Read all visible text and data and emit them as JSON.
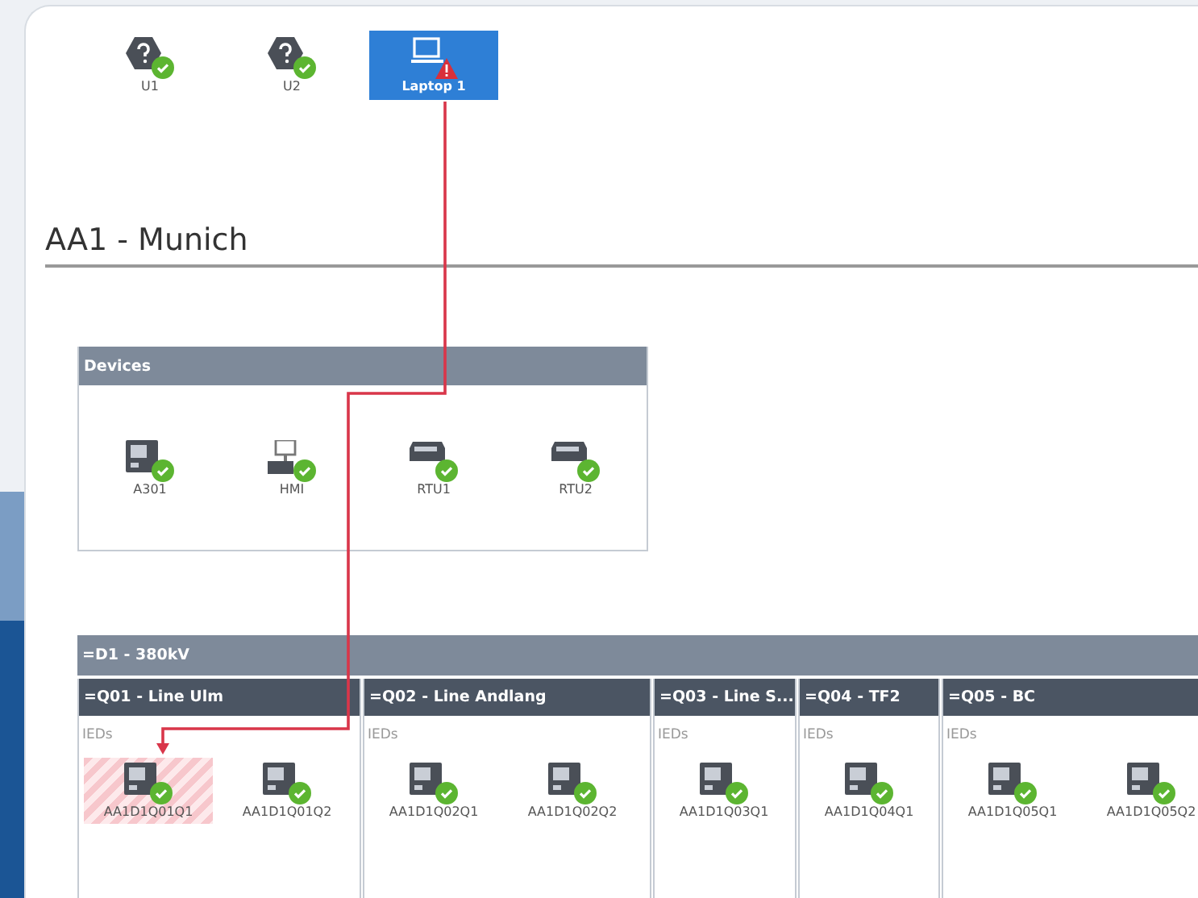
{
  "users": [
    {
      "label": "U1",
      "kind": "unknown",
      "alert": false,
      "selected": false
    },
    {
      "label": "U2",
      "kind": "unknown",
      "alert": false,
      "selected": false
    },
    {
      "label": "Laptop 1",
      "kind": "laptop",
      "alert": true,
      "selected": true
    }
  ],
  "title": "AA1 - Munich",
  "devices": {
    "title": "Devices",
    "items": [
      {
        "label": "A301",
        "kind": "ied",
        "alert": false
      },
      {
        "label": "HMI",
        "kind": "hmi",
        "alert": false
      },
      {
        "label": "RTU1",
        "kind": "rtu",
        "alert": false
      },
      {
        "label": "RTU2",
        "kind": "rtu",
        "alert": false
      }
    ]
  },
  "voltage_level": {
    "title": "=D1 - 380kV",
    "bays": [
      {
        "title": "=Q01 - Line Ulm",
        "group_label": "IEDs",
        "ieds": [
          {
            "label": "AA1D1Q01Q1",
            "kind": "ied",
            "alert": false,
            "selected": true
          },
          {
            "label": "AA1D1Q01Q2",
            "kind": "ied",
            "alert": false,
            "selected": false
          }
        ]
      },
      {
        "title": "=Q02 - Line Andlang",
        "group_label": "IEDs",
        "ieds": [
          {
            "label": "AA1D1Q02Q1",
            "kind": "ied",
            "alert": false,
            "selected": false
          },
          {
            "label": "AA1D1Q02Q2",
            "kind": "ied",
            "alert": false,
            "selected": false
          }
        ]
      },
      {
        "title": "=Q03 - Line S...",
        "group_label": "IEDs",
        "ieds": [
          {
            "label": "AA1D1Q03Q1",
            "kind": "ied",
            "alert": false,
            "selected": false
          }
        ]
      },
      {
        "title": "=Q04 - TF2",
        "group_label": "IEDs",
        "ieds": [
          {
            "label": "AA1D1Q04Q1",
            "kind": "ied",
            "alert": false,
            "selected": false
          }
        ]
      },
      {
        "title": "=Q05 - BC",
        "group_label": "IEDs",
        "ieds": [
          {
            "label": "AA1D1Q05Q1",
            "kind": "ied",
            "alert": false,
            "selected": false
          },
          {
            "label": "AA1D1Q05Q2",
            "kind": "ied",
            "alert": false,
            "selected": false
          }
        ]
      }
    ]
  }
}
